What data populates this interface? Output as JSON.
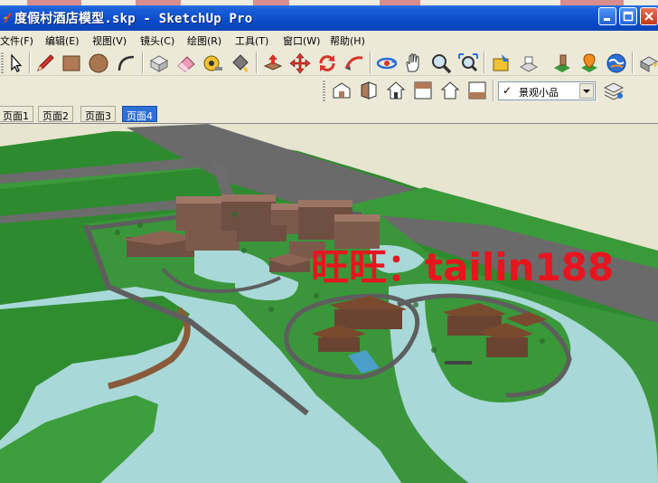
{
  "window": {
    "title": "度假村酒店模型.skp - SketchUp Pro",
    "colors": {
      "titlebar": "#0a4ac9",
      "accent": "#2f6fd8"
    }
  },
  "menu": {
    "items": [
      {
        "label": "文件(F)"
      },
      {
        "label": "编辑(E)"
      },
      {
        "label": "视图(V)"
      },
      {
        "label": "镜头(C)"
      },
      {
        "label": "绘图(R)"
      },
      {
        "label": "工具(T)"
      },
      {
        "label": "窗口(W)"
      },
      {
        "label": "帮助(H)"
      }
    ]
  },
  "toolbar": {
    "tools": [
      "select-icon",
      "pencil-icon",
      "rectangle-icon",
      "circle-icon",
      "arc-icon",
      "component-icon",
      "eraser-icon",
      "tape-measure-icon",
      "paint-bucket-icon",
      "push-pull-icon",
      "move-icon",
      "rotate-icon",
      "follow-me-icon",
      "orbit-icon",
      "pan-icon",
      "zoom-icon",
      "zoom-extents-icon",
      "get-models-icon",
      "share-model-icon",
      "google-earth-icon",
      "add-location-icon",
      "globe-icon",
      "export-icon"
    ],
    "views": [
      "iso-view-icon",
      "top-view-icon",
      "front-view-icon",
      "right-view-icon",
      "back-view-icon",
      "left-view-icon"
    ],
    "layer": {
      "checked": "✓",
      "current": "景观小品"
    },
    "layer_manager_icon": "layers-icon"
  },
  "scenes": {
    "tabs": [
      {
        "label": "页面1"
      },
      {
        "label": "页面2"
      },
      {
        "label": "页面3"
      },
      {
        "label": "页面4",
        "active": true
      }
    ]
  },
  "viewport": {
    "watermark": "旺旺：tailin188",
    "colors": {
      "ground": "#2e8a2e",
      "water": "#a8d8d8",
      "road": "#6c6c6c",
      "sky": "#e7e4d0",
      "watermark": "#e8141e"
    }
  }
}
